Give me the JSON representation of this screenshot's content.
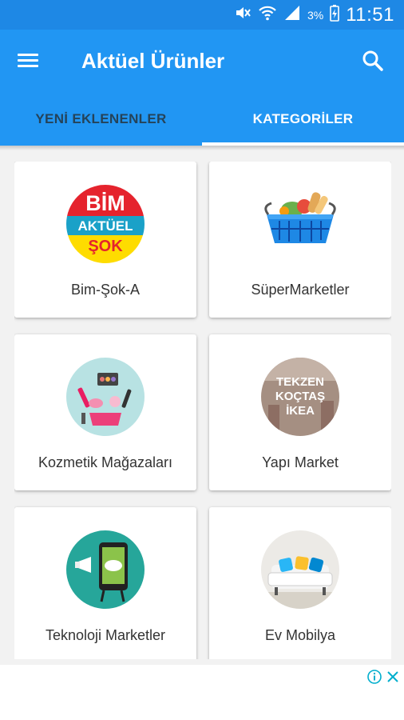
{
  "status_bar": {
    "battery": "3%",
    "time": "11:51"
  },
  "app_bar": {
    "title": "Aktüel Ürünler"
  },
  "tabs": [
    {
      "label": "YENİ EKLENENLER",
      "active": false
    },
    {
      "label": "KATEGORİLER",
      "active": true
    }
  ],
  "categories": [
    {
      "label": "Bim-Şok-A",
      "logo_text": [
        "BİM",
        "AKTÜEL",
        "ŞOK"
      ]
    },
    {
      "label": "SüperMarketler"
    },
    {
      "label": "Kozmetik Mağazaları"
    },
    {
      "label": "Yapı Market",
      "logo_text": [
        "TEKZEN",
        "KOÇTAŞ",
        "İKEA"
      ]
    },
    {
      "label": "Teknoloji Marketler"
    },
    {
      "label": "Ev Mobilya"
    }
  ],
  "colors": {
    "primary": "#2196f3",
    "status_bar": "#1e88e5",
    "background": "#f2f2f2"
  },
  "icons": {
    "menu": "menu-icon",
    "search": "search-icon",
    "ad_info": "info-icon",
    "ad_close": "close-icon"
  }
}
